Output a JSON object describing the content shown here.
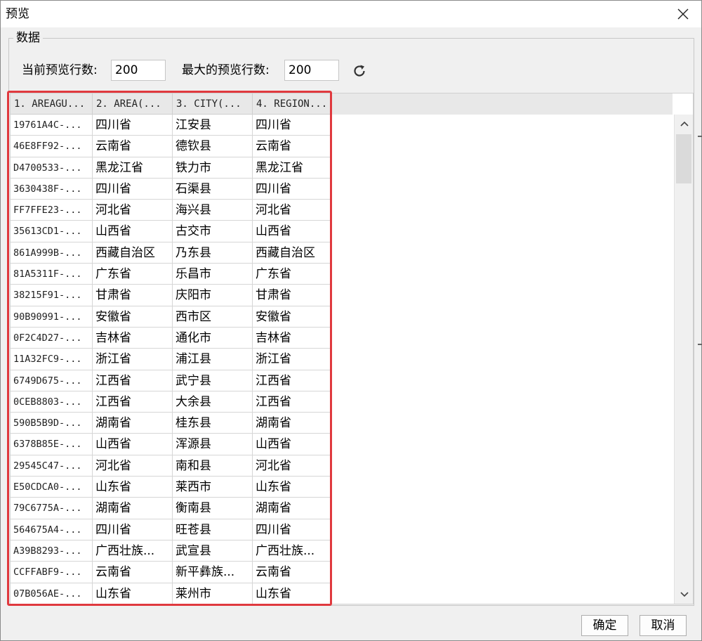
{
  "window": {
    "title": "预览"
  },
  "group": {
    "label": "数据"
  },
  "settings": {
    "current_rows_label": "当前预览行数:",
    "current_rows_value": "200",
    "max_rows_label": "最大的预览行数:",
    "max_rows_value": "200"
  },
  "table": {
    "columns": [
      "1. AREAGU...",
      "2. AREA(...",
      "3. CITY(...",
      "4. REGION..."
    ],
    "rows": [
      [
        "19761A4C-...",
        "四川省",
        "江安县",
        "四川省"
      ],
      [
        "46E8FF92-...",
        "云南省",
        "德钦县",
        "云南省"
      ],
      [
        "D4700533-...",
        "黑龙江省",
        "铁力市",
        "黑龙江省"
      ],
      [
        "3630438F-...",
        "四川省",
        "石渠县",
        "四川省"
      ],
      [
        "FF7FFE23-...",
        "河北省",
        "海兴县",
        "河北省"
      ],
      [
        "35613CD1-...",
        "山西省",
        "古交市",
        "山西省"
      ],
      [
        "861A999B-...",
        "西藏自治区",
        "乃东县",
        "西藏自治区"
      ],
      [
        "81A5311F-...",
        "广东省",
        "乐昌市",
        "广东省"
      ],
      [
        "38215F91-...",
        "甘肃省",
        "庆阳市",
        "甘肃省"
      ],
      [
        "90B90991-...",
        "安徽省",
        "西市区",
        "安徽省"
      ],
      [
        "0F2C4D27-...",
        "吉林省",
        "通化市",
        "吉林省"
      ],
      [
        "11A32FC9-...",
        "浙江省",
        "浦江县",
        "浙江省"
      ],
      [
        "6749D675-...",
        "江西省",
        "武宁县",
        "江西省"
      ],
      [
        "0CEB8803-...",
        "江西省",
        "大余县",
        "江西省"
      ],
      [
        "590B5B9D-...",
        "湖南省",
        "桂东县",
        "湖南省"
      ],
      [
        "6378B85E-...",
        "山西省",
        "浑源县",
        "山西省"
      ],
      [
        "29545C47-...",
        "河北省",
        "南和县",
        "河北省"
      ],
      [
        "E50CDCA0-...",
        "山东省",
        "莱西市",
        "山东省"
      ],
      [
        "79C6775A-...",
        "湖南省",
        "衡南县",
        "湖南省"
      ],
      [
        "564675A4-...",
        "四川省",
        "旺苍县",
        "四川省"
      ],
      [
        "A39B8293-...",
        "广西壮族...",
        "武宣县",
        "广西壮族..."
      ],
      [
        "CCFFABF9-...",
        "云南省",
        "新平彝族...",
        "云南省"
      ],
      [
        "07B056AE-...",
        "山东省",
        "莱州市",
        "山东省"
      ]
    ]
  },
  "buttons": {
    "ok": "确定",
    "cancel": "取消"
  },
  "icons": {
    "close": "close-icon",
    "refresh": "refresh-icon",
    "scroll_up": "chevron-up-icon",
    "scroll_down": "chevron-down-icon"
  },
  "colors": {
    "highlight": "#e0393e",
    "header_bg": "#e8e8e8",
    "window_bg": "#f0f0f0"
  }
}
